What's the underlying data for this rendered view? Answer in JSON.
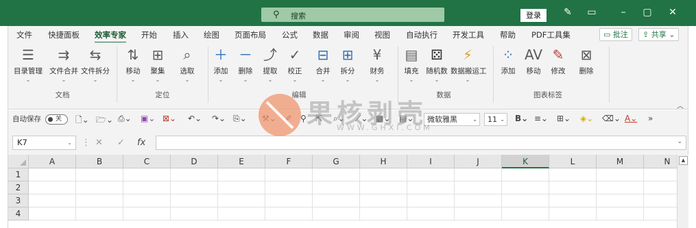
{
  "titlebar": {
    "search_placeholder": "搜索",
    "login_label": "登录",
    "icons": [
      "search-icon",
      "pen-icon",
      "ribbon-display-icon",
      "minimize-icon",
      "maximize-icon",
      "close-icon"
    ]
  },
  "tabs": {
    "items": [
      "文件",
      "快捷面板",
      "效率专家",
      "开始",
      "插入",
      "绘图",
      "页面布局",
      "公式",
      "数据",
      "审阅",
      "视图",
      "自动执行",
      "开发工具",
      "帮助",
      "PDF工具集"
    ],
    "active": "效率专家",
    "comment_label": "批注",
    "share_label": "共享"
  },
  "ribbon": {
    "buttons": [
      {
        "label": "目录管理",
        "icon": "document-list-icon"
      },
      {
        "label": "文件合并",
        "icon": "merge-files-icon"
      },
      {
        "label": "文件拆分",
        "icon": "split-files-icon"
      },
      {
        "label": "移动",
        "icon": "move-icon"
      },
      {
        "label": "聚集",
        "icon": "grid-icon"
      },
      {
        "label": "选取",
        "icon": "select-icon"
      },
      {
        "label": "添加",
        "icon": "plus-icon"
      },
      {
        "label": "删除",
        "icon": "minus-icon"
      },
      {
        "label": "提取",
        "icon": "extract-icon"
      },
      {
        "label": "校正",
        "icon": "correct-icon"
      },
      {
        "label": "合并",
        "icon": "merge-cells-icon"
      },
      {
        "label": "拆分",
        "icon": "split-cells-icon"
      },
      {
        "label": "财务",
        "icon": "finance-icon"
      },
      {
        "label": "填充",
        "icon": "fill-icon"
      },
      {
        "label": "随机数",
        "icon": "dice-icon"
      },
      {
        "label": "数据搬运工",
        "icon": "data-mover-icon"
      },
      {
        "label": "添加",
        "icon": "scatter-add-icon"
      },
      {
        "label": "移动",
        "icon": "av-move-icon"
      },
      {
        "label": "修改",
        "icon": "edit-pen-icon"
      },
      {
        "label": "删除",
        "icon": "chart-delete-icon"
      }
    ],
    "groups": [
      "文档",
      "定位",
      "编辑",
      "数据",
      "图表标签"
    ]
  },
  "qat": {
    "autosave_label": "自动保存",
    "autosave_state": "关",
    "font_name": "微软雅黑",
    "font_size": "11",
    "bold_label": "B"
  },
  "formula_bar": {
    "name_box": "K7",
    "fx_label": "fx",
    "formula": ""
  },
  "grid": {
    "columns": [
      "A",
      "B",
      "C",
      "D",
      "E",
      "F",
      "G",
      "H",
      "I",
      "J",
      "K",
      "L",
      "M",
      "N"
    ],
    "rows": [
      "1",
      "2",
      "3",
      "4"
    ],
    "selected_column": "K"
  },
  "watermark": {
    "title": "果核剥壳",
    "subtitle": "WWW.GHXI.COM"
  },
  "colors": {
    "accent": "#217346",
    "search_bg": "#9fc9a7",
    "ribbon_bg": "#f3f3f3"
  }
}
